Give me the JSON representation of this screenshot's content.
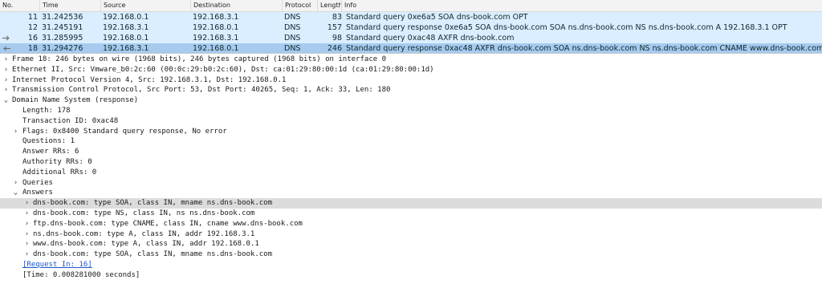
{
  "packet_list": {
    "columns": {
      "no": "No.",
      "time": "Time",
      "source": "Source",
      "destination": "Destination",
      "protocol": "Protocol",
      "length": "Length",
      "info": "Info"
    },
    "rows": [
      {
        "no": "11",
        "time": "31.242536",
        "source": "192.168.0.1",
        "destination": "192.168.3.1",
        "protocol": "DNS",
        "length": "83",
        "info": "Standard query 0xe6a5 SOA dns-book.com OPT"
      },
      {
        "no": "12",
        "time": "31.245191",
        "source": "192.168.3.1",
        "destination": "192.168.0.1",
        "protocol": "DNS",
        "length": "157",
        "info": "Standard query response 0xe6a5 SOA dns-book.com SOA ns.dns-book.com NS ns.dns-book.com A 192.168.3.1 OPT"
      },
      {
        "no": "16",
        "time": "31.285995",
        "source": "192.168.0.1",
        "destination": "192.168.3.1",
        "protocol": "DNS",
        "length": "98",
        "info": "Standard query 0xac48 AXFR dns-book.com"
      },
      {
        "no": "18",
        "time": "31.294276",
        "source": "192.168.3.1",
        "destination": "192.168.0.1",
        "protocol": "DNS",
        "length": "246",
        "info": "Standard query response 0xac48 AXFR dns-book.com SOA ns.dns-book.com NS ns.dns-book.com CNAME www.dns-book.com"
      }
    ],
    "selected_row": "18"
  },
  "detail": {
    "frame": "Frame 18: 246 bytes on wire (1968 bits), 246 bytes captured (1968 bits) on interface 0",
    "ethernet": "Ethernet II, Src: Vmware_b0:2c:60 (00:0c:29:b0:2c:60), Dst: ca:01:29:80:00:1d (ca:01:29:80:00:1d)",
    "ip": "Internet Protocol Version 4, Src: 192.168.3.1, Dst: 192.168.0.1",
    "tcp": "Transmission Control Protocol, Src Port: 53, Dst Port: 40265, Seq: 1, Ack: 33, Len: 180",
    "dns": "Domain Name System (response)",
    "dns_fields": {
      "length": "Length: 178",
      "transaction_id": "Transaction ID: 0xac48",
      "flags": "Flags: 0x8400 Standard query response, No error",
      "questions": "Questions: 1",
      "answer_rrs": "Answer RRs: 6",
      "authority_rrs": "Authority RRs: 0",
      "additional_rrs": "Additional RRs: 0",
      "queries": "Queries",
      "answers": "Answers"
    },
    "answers": [
      "dns-book.com: type SOA, class IN, mname ns.dns-book.com",
      "dns-book.com: type NS, class IN, ns ns.dns-book.com",
      "ftp.dns-book.com: type CNAME, class IN, cname www.dns-book.com",
      "ns.dns-book.com: type A, class IN, addr 192.168.3.1",
      "www.dns-book.com: type A, class IN, addr 192.168.0.1",
      "dns-book.com: type SOA, class IN, mname ns.dns-book.com"
    ],
    "request_in": "[Request In: 16]",
    "time": "[Time: 0.008281000 seconds]"
  },
  "icons": {
    "collapsed": "chevron-right-icon",
    "expanded": "chevron-down-icon"
  },
  "colors": {
    "dns_row": "#daeeff",
    "selected_row": "#a6cbef",
    "highlight": "#dcdcdc",
    "link": "#1a56c9"
  }
}
